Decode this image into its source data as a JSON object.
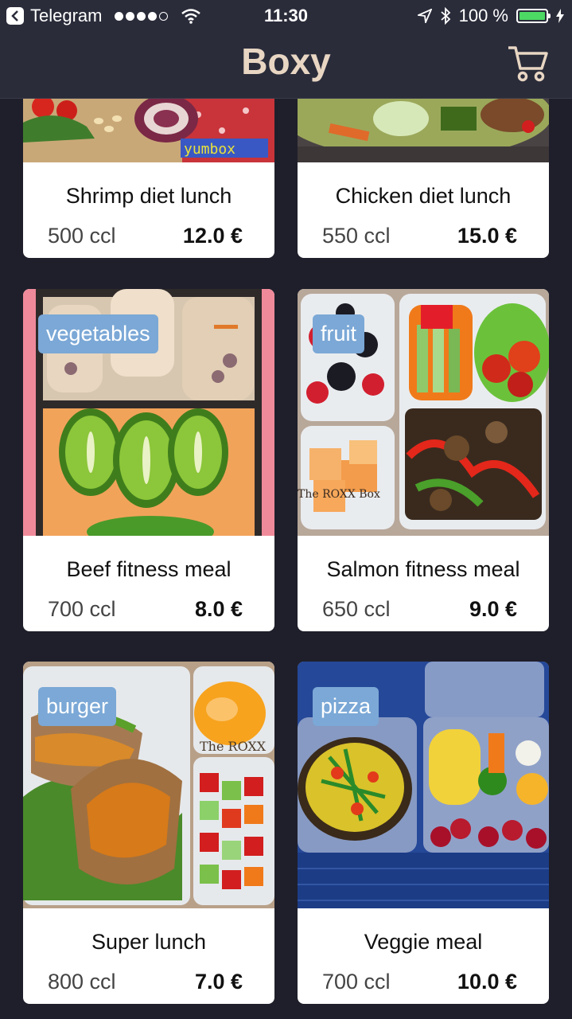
{
  "status": {
    "carrier": "Telegram",
    "time": "11:30",
    "battery": "100 %"
  },
  "header": {
    "title": "Boxy",
    "cart_icon": "shopping-cart-icon"
  },
  "meals": [
    {
      "name": "Shrimp diet lunch",
      "calories": "500 ccl",
      "price": "12.0 €",
      "tag": "",
      "watermark": "yumbox"
    },
    {
      "name": "Chicken diet lunch",
      "calories": "550 ccl",
      "price": "15.0 €",
      "tag": ""
    },
    {
      "name": "Beef fitness meal",
      "calories": "700 ccl",
      "price": "8.0 €",
      "tag": "vegetables"
    },
    {
      "name": "Salmon fitness meal",
      "calories": "650 ccl",
      "price": "9.0 €",
      "tag": "fruit",
      "watermark": "The ROXX Box"
    },
    {
      "name": "Super lunch",
      "calories": "800 ccl",
      "price": "7.0 €",
      "tag": "burger",
      "watermark": "The ROXX"
    },
    {
      "name": "Veggie meal",
      "calories": "700 ccl",
      "price": "10.0 €",
      "tag": "pizza"
    }
  ],
  "colors": {
    "background": "#1f1f2b",
    "bar": "#2a2c3a",
    "title": "#e8d6c3",
    "tag": "#7ba8d6",
    "battery": "#4cd964"
  }
}
